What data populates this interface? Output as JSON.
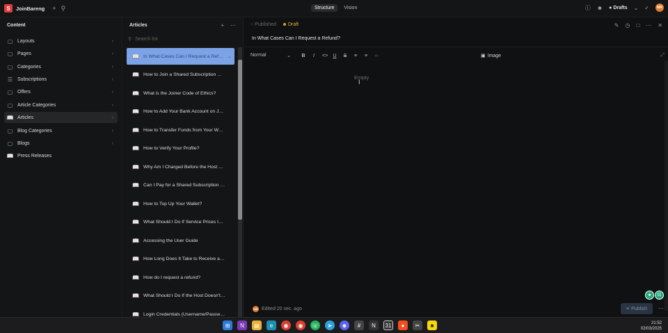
{
  "app": {
    "name": "JoinBareng",
    "logo_letter": "S",
    "brand_color": "#e03a3a"
  },
  "topbar": {
    "tabs": [
      {
        "label": "Structure",
        "active": true
      },
      {
        "label": "Vision",
        "active": false
      }
    ],
    "drafts_label": "Drafts",
    "avatar_initials": "MR"
  },
  "sidebar": {
    "title": "Content",
    "items": [
      {
        "label": "Layouts",
        "icon": "document-icon",
        "selected": false
      },
      {
        "label": "Pages",
        "icon": "document-icon",
        "selected": false
      },
      {
        "label": "Categories",
        "icon": "document-icon",
        "selected": false
      },
      {
        "label": "Subscriptions",
        "icon": "list-icon",
        "selected": false
      },
      {
        "label": "Offers",
        "icon": "document-icon",
        "selected": false
      },
      {
        "label": "Article Categories",
        "icon": "document-icon",
        "selected": false
      },
      {
        "label": "Articles",
        "icon": "book-icon",
        "selected": true
      },
      {
        "label": "Blog Categories",
        "icon": "document-icon",
        "selected": false
      },
      {
        "label": "Blogs",
        "icon": "document-icon",
        "selected": false
      },
      {
        "label": "Press Releases",
        "icon": "book-icon",
        "selected": false
      }
    ]
  },
  "articles": {
    "title": "Articles",
    "search_placeholder": "Search list",
    "items": [
      {
        "label": "In What Cases Can I Request a Refund?",
        "selected": true
      },
      {
        "label": "How to Join a Shared Subscription Group?",
        "selected": false
      },
      {
        "label": "What is the Joiner Code of Ethics?",
        "selected": false
      },
      {
        "label": "How to Add Your Bank Account on JoinBareng?",
        "selected": false
      },
      {
        "label": "How to Transfer Funds from Your Wallet?",
        "selected": false
      },
      {
        "label": "How to Verify Your Profile?",
        "selected": false
      },
      {
        "label": "Why Am I Charged Before the Host Approves?",
        "selected": false
      },
      {
        "label": "Can I Pay for a Shared Subscription with Wallet?",
        "selected": false
      },
      {
        "label": "How to Top Up Your Wallet?",
        "selected": false
      },
      {
        "label": "What Should I Do If Service Prices Increase?",
        "selected": false
      },
      {
        "label": "Accessing the User Guide",
        "selected": false
      },
      {
        "label": "How Long Does It Take to Receive a Refund?",
        "selected": false
      },
      {
        "label": "How do I request a refund?",
        "selected": false
      },
      {
        "label": "What Should I Do If the Host Doesn't Respond?",
        "selected": false
      },
      {
        "label": "Login Credentials (Username/Password)",
        "selected": false
      }
    ]
  },
  "editor": {
    "status_published": "Published",
    "status_draft": "Draft",
    "doc_title": "In What Cases Can I Request a Refund?",
    "block_style": "Normal",
    "toolbar": {
      "bold": "B",
      "italic": "I",
      "code": "<>",
      "underline": "U",
      "strike": "S",
      "image_label": "Image"
    },
    "empty_placeholder": "Empty",
    "edited_text": "Edited 20 sec. ago",
    "publish_label": "Publish",
    "avatar_initials": "MR"
  },
  "taskbar": {
    "time": "21:52",
    "date": "02/03/2025"
  }
}
